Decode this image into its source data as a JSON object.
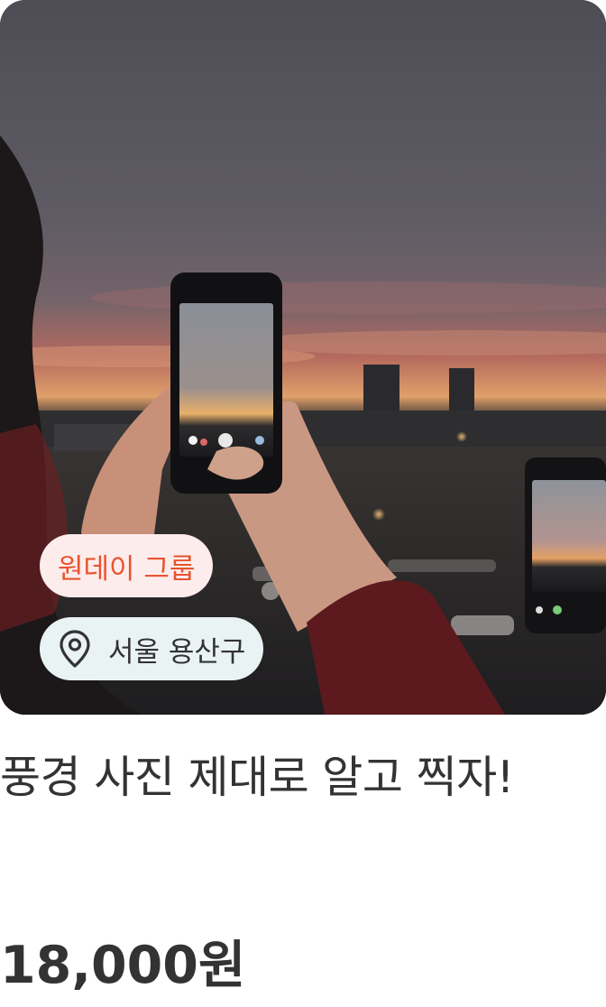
{
  "class_card": {
    "image_alt": "sunset photography",
    "category_badge": "원데이 그룹",
    "location_icon": "location-pin-icon",
    "location": "서울 용산구",
    "title": "풍경 사진 제대로 알고 찍자!",
    "price": "18,000원"
  },
  "colors": {
    "category_bg": "#fdecec",
    "category_text": "#e8542f",
    "location_bg": "#e9f3f3",
    "text": "#333333"
  }
}
